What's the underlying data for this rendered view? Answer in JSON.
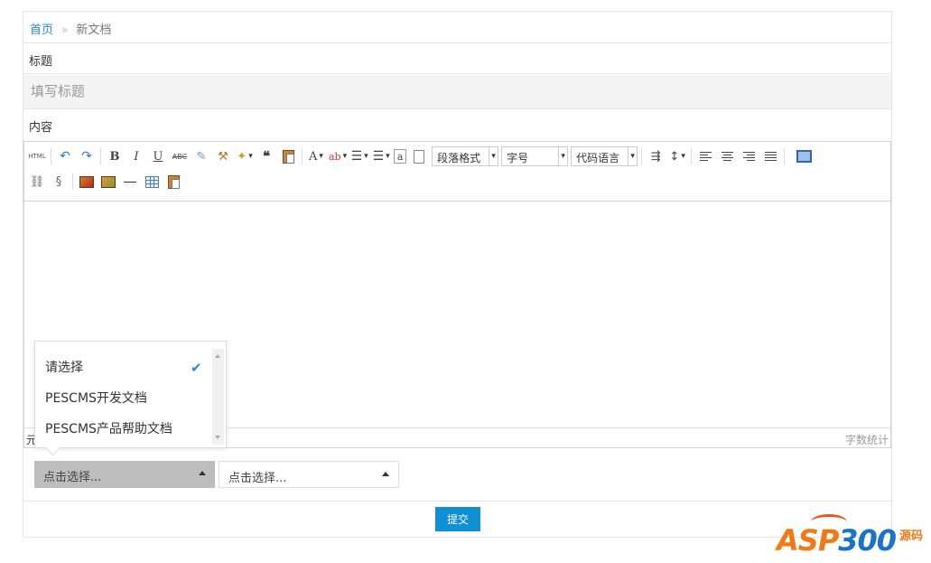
{
  "breadcrumb": {
    "home": "首页",
    "separator": "»",
    "current": "新文档"
  },
  "form": {
    "title_label": "标题",
    "title_placeholder": "填写标题",
    "content_label": "内容"
  },
  "editor": {
    "toolbar": {
      "html_button": "HTML",
      "bold": "B",
      "italic": "I",
      "underline": "U",
      "strike": "ABC",
      "font_color": "A",
      "paragraph_format": "段落格式",
      "font_size": "字号",
      "code_language": "代码语言"
    },
    "statusbar": {
      "element_path": "元",
      "word_count": "字数统计"
    }
  },
  "category_selects": {
    "first": "点击选择...",
    "second": "点击选择..."
  },
  "dropdown": {
    "options": [
      "请选择",
      "PESCMS开发文档",
      "PESCMS产品帮助文档"
    ],
    "selected_index": 0
  },
  "submit_label": "提交",
  "watermark": {
    "brand_a": "ASP",
    "brand_b": "300",
    "suffix": "源码"
  },
  "colors": {
    "link": "#2a8bc2",
    "primary_button": "#0e90d2",
    "watermark_orange": "#f07a18",
    "watermark_blue": "#1a73c8"
  }
}
